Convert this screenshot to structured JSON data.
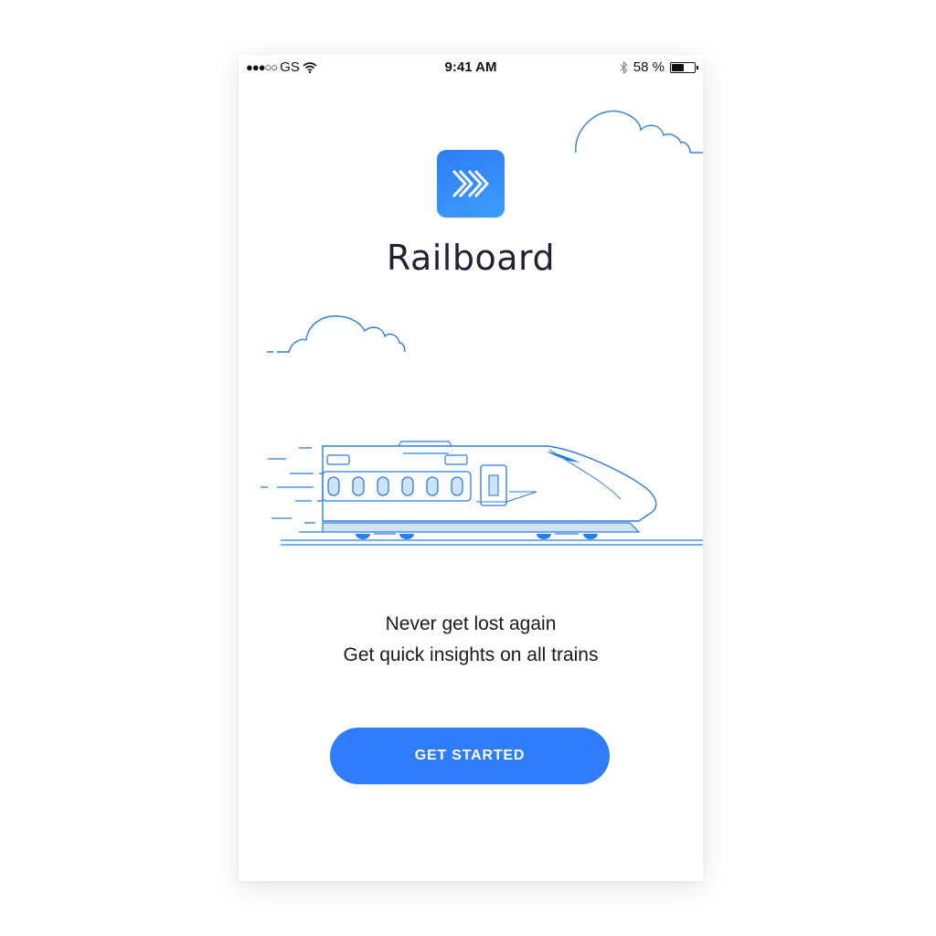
{
  "status_bar": {
    "signal": "●●●○○",
    "carrier": "GS",
    "time": "9:41 AM",
    "battery_percent_label": "58 %",
    "battery_level": 0.58
  },
  "app": {
    "icon_name": "double-chevron-right-icon",
    "title": "Railboard"
  },
  "illustration": {
    "subject": "train-illustration",
    "accent_color": "#2a7de1"
  },
  "tagline": {
    "line1": "Never get lost again",
    "line2": "Get quick insights on all trains"
  },
  "cta": {
    "label": "GET STARTED",
    "color": "#2f7dfb"
  }
}
